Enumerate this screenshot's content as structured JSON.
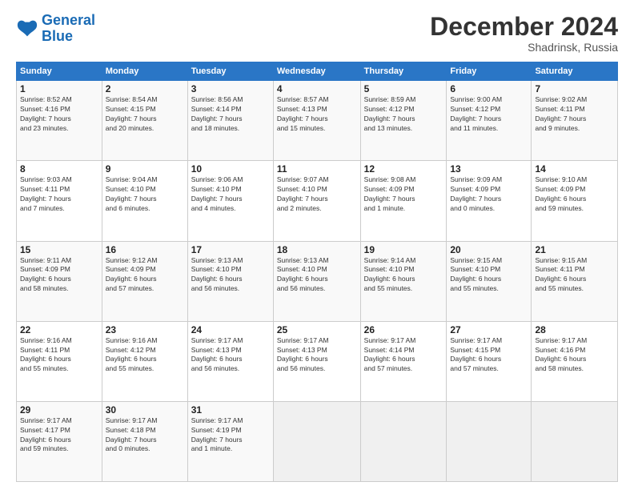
{
  "header": {
    "logo_line1": "General",
    "logo_line2": "Blue",
    "month_title": "December 2024",
    "location": "Shadrinsk, Russia"
  },
  "days_of_week": [
    "Sunday",
    "Monday",
    "Tuesday",
    "Wednesday",
    "Thursday",
    "Friday",
    "Saturday"
  ],
  "weeks": [
    [
      {
        "day": "1",
        "info": "Sunrise: 8:52 AM\nSunset: 4:16 PM\nDaylight: 7 hours\nand 23 minutes."
      },
      {
        "day": "2",
        "info": "Sunrise: 8:54 AM\nSunset: 4:15 PM\nDaylight: 7 hours\nand 20 minutes."
      },
      {
        "day": "3",
        "info": "Sunrise: 8:56 AM\nSunset: 4:14 PM\nDaylight: 7 hours\nand 18 minutes."
      },
      {
        "day": "4",
        "info": "Sunrise: 8:57 AM\nSunset: 4:13 PM\nDaylight: 7 hours\nand 15 minutes."
      },
      {
        "day": "5",
        "info": "Sunrise: 8:59 AM\nSunset: 4:12 PM\nDaylight: 7 hours\nand 13 minutes."
      },
      {
        "day": "6",
        "info": "Sunrise: 9:00 AM\nSunset: 4:12 PM\nDaylight: 7 hours\nand 11 minutes."
      },
      {
        "day": "7",
        "info": "Sunrise: 9:02 AM\nSunset: 4:11 PM\nDaylight: 7 hours\nand 9 minutes."
      }
    ],
    [
      {
        "day": "8",
        "info": "Sunrise: 9:03 AM\nSunset: 4:11 PM\nDaylight: 7 hours\nand 7 minutes."
      },
      {
        "day": "9",
        "info": "Sunrise: 9:04 AM\nSunset: 4:10 PM\nDaylight: 7 hours\nand 6 minutes."
      },
      {
        "day": "10",
        "info": "Sunrise: 9:06 AM\nSunset: 4:10 PM\nDaylight: 7 hours\nand 4 minutes."
      },
      {
        "day": "11",
        "info": "Sunrise: 9:07 AM\nSunset: 4:10 PM\nDaylight: 7 hours\nand 2 minutes."
      },
      {
        "day": "12",
        "info": "Sunrise: 9:08 AM\nSunset: 4:09 PM\nDaylight: 7 hours\nand 1 minute."
      },
      {
        "day": "13",
        "info": "Sunrise: 9:09 AM\nSunset: 4:09 PM\nDaylight: 7 hours\nand 0 minutes."
      },
      {
        "day": "14",
        "info": "Sunrise: 9:10 AM\nSunset: 4:09 PM\nDaylight: 6 hours\nand 59 minutes."
      }
    ],
    [
      {
        "day": "15",
        "info": "Sunrise: 9:11 AM\nSunset: 4:09 PM\nDaylight: 6 hours\nand 58 minutes."
      },
      {
        "day": "16",
        "info": "Sunrise: 9:12 AM\nSunset: 4:09 PM\nDaylight: 6 hours\nand 57 minutes."
      },
      {
        "day": "17",
        "info": "Sunrise: 9:13 AM\nSunset: 4:10 PM\nDaylight: 6 hours\nand 56 minutes."
      },
      {
        "day": "18",
        "info": "Sunrise: 9:13 AM\nSunset: 4:10 PM\nDaylight: 6 hours\nand 56 minutes."
      },
      {
        "day": "19",
        "info": "Sunrise: 9:14 AM\nSunset: 4:10 PM\nDaylight: 6 hours\nand 55 minutes."
      },
      {
        "day": "20",
        "info": "Sunrise: 9:15 AM\nSunset: 4:10 PM\nDaylight: 6 hours\nand 55 minutes."
      },
      {
        "day": "21",
        "info": "Sunrise: 9:15 AM\nSunset: 4:11 PM\nDaylight: 6 hours\nand 55 minutes."
      }
    ],
    [
      {
        "day": "22",
        "info": "Sunrise: 9:16 AM\nSunset: 4:11 PM\nDaylight: 6 hours\nand 55 minutes."
      },
      {
        "day": "23",
        "info": "Sunrise: 9:16 AM\nSunset: 4:12 PM\nDaylight: 6 hours\nand 55 minutes."
      },
      {
        "day": "24",
        "info": "Sunrise: 9:17 AM\nSunset: 4:13 PM\nDaylight: 6 hours\nand 56 minutes."
      },
      {
        "day": "25",
        "info": "Sunrise: 9:17 AM\nSunset: 4:13 PM\nDaylight: 6 hours\nand 56 minutes."
      },
      {
        "day": "26",
        "info": "Sunrise: 9:17 AM\nSunset: 4:14 PM\nDaylight: 6 hours\nand 57 minutes."
      },
      {
        "day": "27",
        "info": "Sunrise: 9:17 AM\nSunset: 4:15 PM\nDaylight: 6 hours\nand 57 minutes."
      },
      {
        "day": "28",
        "info": "Sunrise: 9:17 AM\nSunset: 4:16 PM\nDaylight: 6 hours\nand 58 minutes."
      }
    ],
    [
      {
        "day": "29",
        "info": "Sunrise: 9:17 AM\nSunset: 4:17 PM\nDaylight: 6 hours\nand 59 minutes."
      },
      {
        "day": "30",
        "info": "Sunrise: 9:17 AM\nSunset: 4:18 PM\nDaylight: 7 hours\nand 0 minutes."
      },
      {
        "day": "31",
        "info": "Sunrise: 9:17 AM\nSunset: 4:19 PM\nDaylight: 7 hours\nand 1 minute."
      },
      {
        "day": "",
        "info": ""
      },
      {
        "day": "",
        "info": ""
      },
      {
        "day": "",
        "info": ""
      },
      {
        "day": "",
        "info": ""
      }
    ]
  ]
}
